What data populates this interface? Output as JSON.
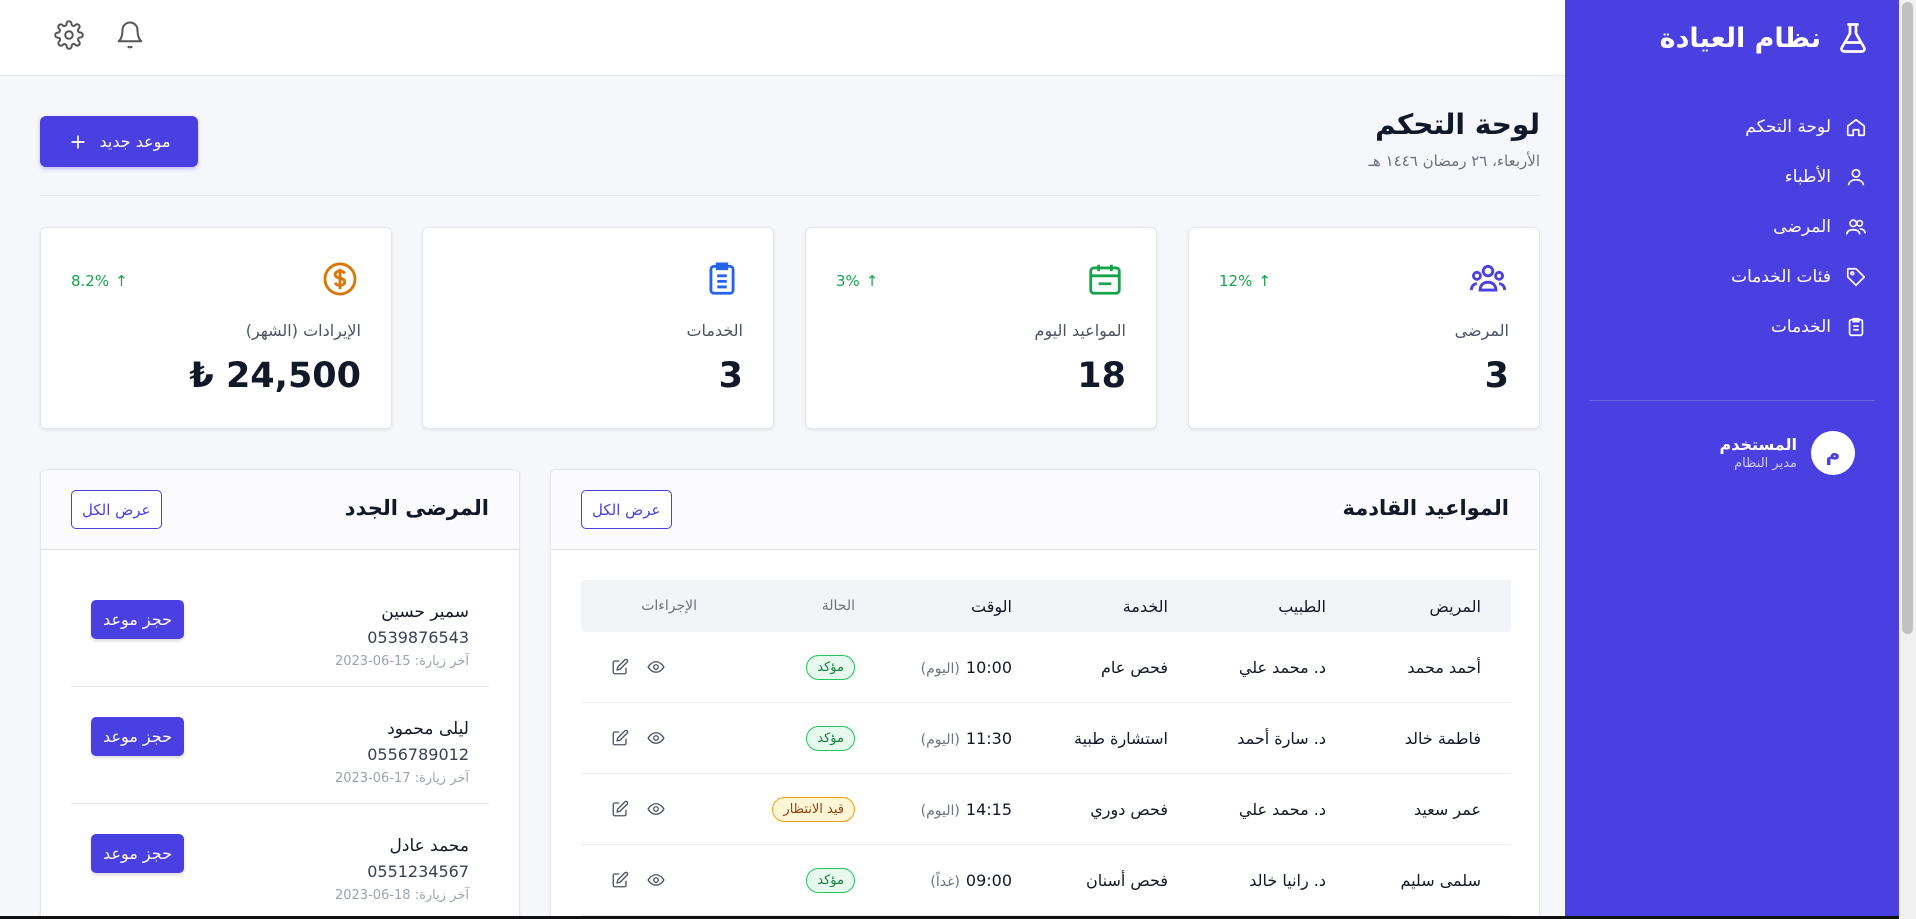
{
  "brand": {
    "title": "نظام العيادة"
  },
  "sidebar": {
    "items": [
      {
        "label": "لوحة التحكم",
        "icon": "home-icon"
      },
      {
        "label": "الأطباء",
        "icon": "user-icon"
      },
      {
        "label": "المرضى",
        "icon": "users-icon"
      },
      {
        "label": "فئات الخدمات",
        "icon": "tag-icon"
      },
      {
        "label": "الخدمات",
        "icon": "clipboard-icon"
      }
    ],
    "user": {
      "initial": "م",
      "name": "المستخدم",
      "role": "مدير النظام"
    }
  },
  "header": {
    "title": "لوحة التحكم",
    "date": "الأربعاء، ٢٦ رمضان ١٤٤٦ هـ",
    "new_button": "موعد جديد"
  },
  "stats": [
    {
      "label": "المرضى",
      "value": "3",
      "trend": "12%",
      "icon": "users-group-icon",
      "color": "#4a3fe0"
    },
    {
      "label": "المواعيد اليوم",
      "value": "18",
      "trend": "3%",
      "icon": "calendar-icon",
      "color": "#16a34a"
    },
    {
      "label": "الخدمات",
      "value": "3",
      "trend": "",
      "icon": "clipboard-list-icon",
      "color": "#2563eb"
    },
    {
      "label": "الإيرادات (الشهر)",
      "value": "24,500 ₺",
      "trend": "8.2%",
      "icon": "dollar-icon",
      "color": "#d97706"
    }
  ],
  "appointments": {
    "title": "المواعيد القادمة",
    "view_all": "عرض الكل",
    "columns": [
      "المريض",
      "الطبيب",
      "الخدمة",
      "الوقت",
      "الحالة",
      "الإجراءات"
    ],
    "rows": [
      {
        "patient": "أحمد محمد",
        "doctor": "د. محمد علي",
        "service": "فحص عام",
        "time": "10:00",
        "suffix": "(اليوم)",
        "status": "مؤكد",
        "status_type": "ok"
      },
      {
        "patient": "فاطمة خالد",
        "doctor": "د. سارة أحمد",
        "service": "استشارة طبية",
        "time": "11:30",
        "suffix": "(اليوم)",
        "status": "مؤكد",
        "status_type": "ok"
      },
      {
        "patient": "عمر سعيد",
        "doctor": "د. محمد علي",
        "service": "فحص دوري",
        "time": "14:15",
        "suffix": "(اليوم)",
        "status": "قيد الانتظار",
        "status_type": "wait"
      },
      {
        "patient": "سلمى سليم",
        "doctor": "د. رانيا خالد",
        "service": "فحص أسنان",
        "time": "09:00",
        "suffix": "(غداً)",
        "status": "مؤكد",
        "status_type": "ok"
      }
    ]
  },
  "new_patients": {
    "title": "المرضى الجدد",
    "view_all": "عرض الكل",
    "book_label": "حجز موعد",
    "items": [
      {
        "name": "سمير حسين",
        "phone": "0539876543",
        "last_visit": "آخر زيارة: 15-06-2023"
      },
      {
        "name": "ليلى محمود",
        "phone": "0556789012",
        "last_visit": "آخر زيارة: 17-06-2023"
      },
      {
        "name": "محمد عادل",
        "phone": "0551234567",
        "last_visit": "آخر زيارة: 18-06-2023"
      }
    ]
  }
}
